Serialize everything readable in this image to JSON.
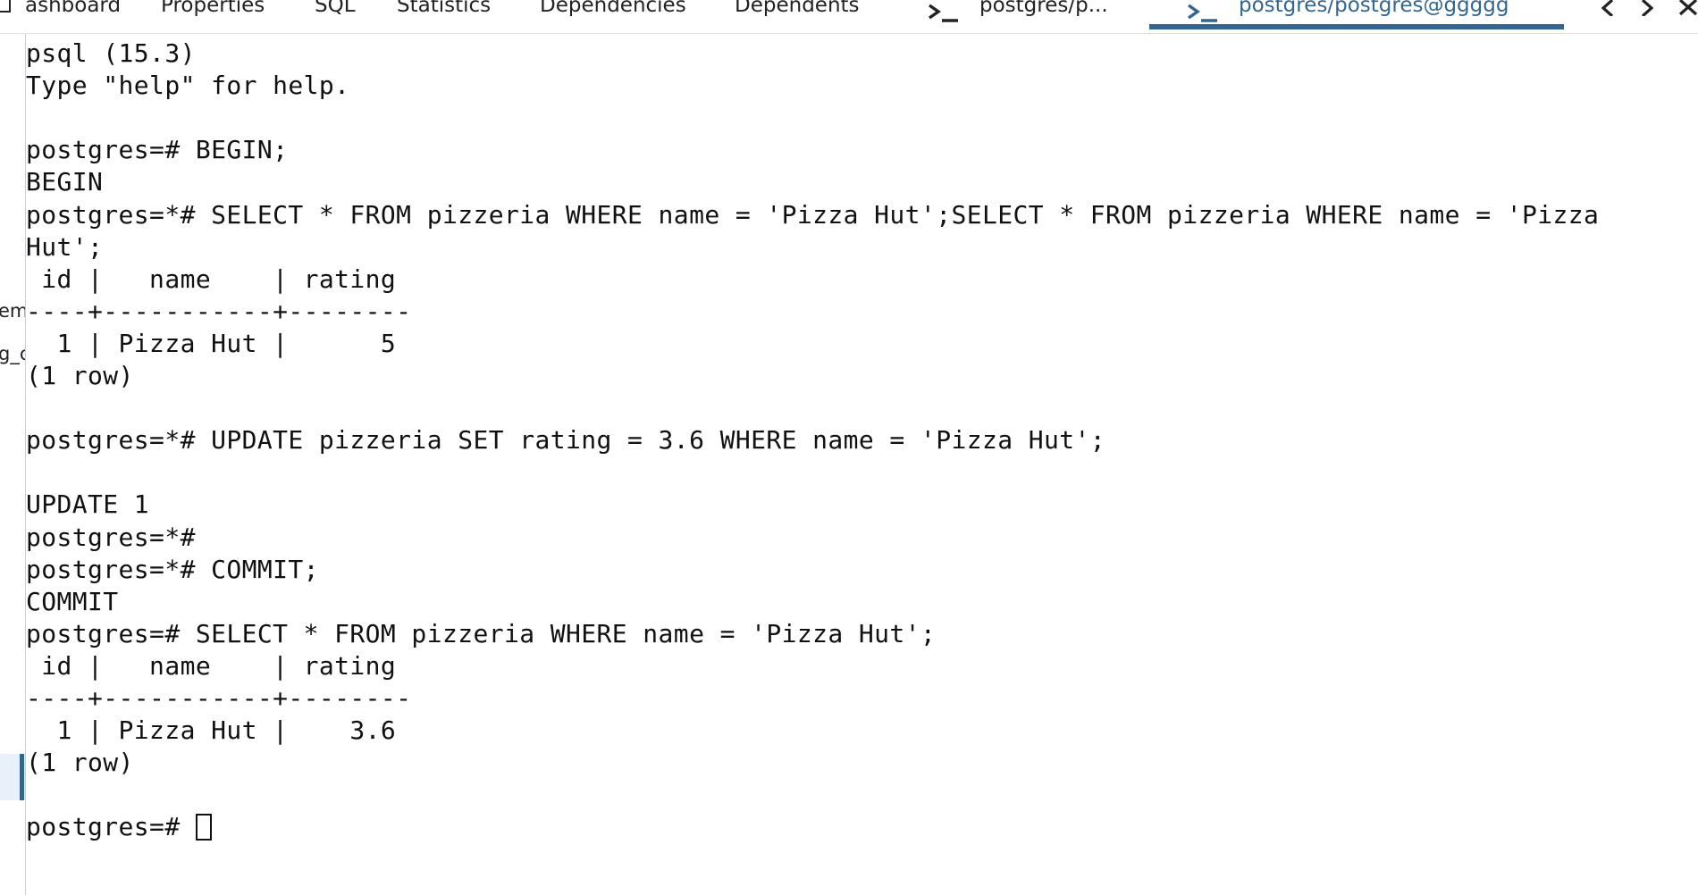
{
  "tabs": [
    {
      "label": "ashboard"
    },
    {
      "label": "Properties"
    },
    {
      "label": "SQL"
    },
    {
      "label": "Statistics"
    },
    {
      "label": "Dependencies"
    },
    {
      "label": "Dependents"
    },
    {
      "label": "postgres/p..."
    },
    {
      "label": "postgres/postgres@ggggg"
    }
  ],
  "accent_color": "#326690",
  "icons": {
    "tab_terminal": "terminal-prompt-icon",
    "nav_prev": "chevron-left-icon",
    "nav_next": "chevron-right-icon",
    "close": "close-icon"
  },
  "left_rail": {
    "fragment_1": "em",
    "fragment_2": "g_c"
  },
  "terminal": {
    "lines": [
      "psql (15.3)",
      "Type \"help\" for help.",
      "",
      "postgres=# BEGIN;",
      "BEGIN",
      "postgres=*# SELECT * FROM pizzeria WHERE name = 'Pizza Hut';SELECT * FROM pizzeria WHERE name = 'Pizza",
      "Hut';",
      " id |   name    | rating",
      "----+-----------+--------",
      "  1 | Pizza Hut |      5",
      "(1 row)",
      "",
      "postgres=*# UPDATE pizzeria SET rating = 3.6 WHERE name = 'Pizza Hut';",
      "",
      "UPDATE 1",
      "postgres=*#",
      "postgres=*# COMMIT;",
      "COMMIT",
      "postgres=# SELECT * FROM pizzeria WHERE name = 'Pizza Hut';",
      " id |   name    | rating",
      "----+-----------+--------",
      "  1 | Pizza Hut |    3.6",
      "(1 row)",
      "",
      "postgres=# "
    ]
  }
}
